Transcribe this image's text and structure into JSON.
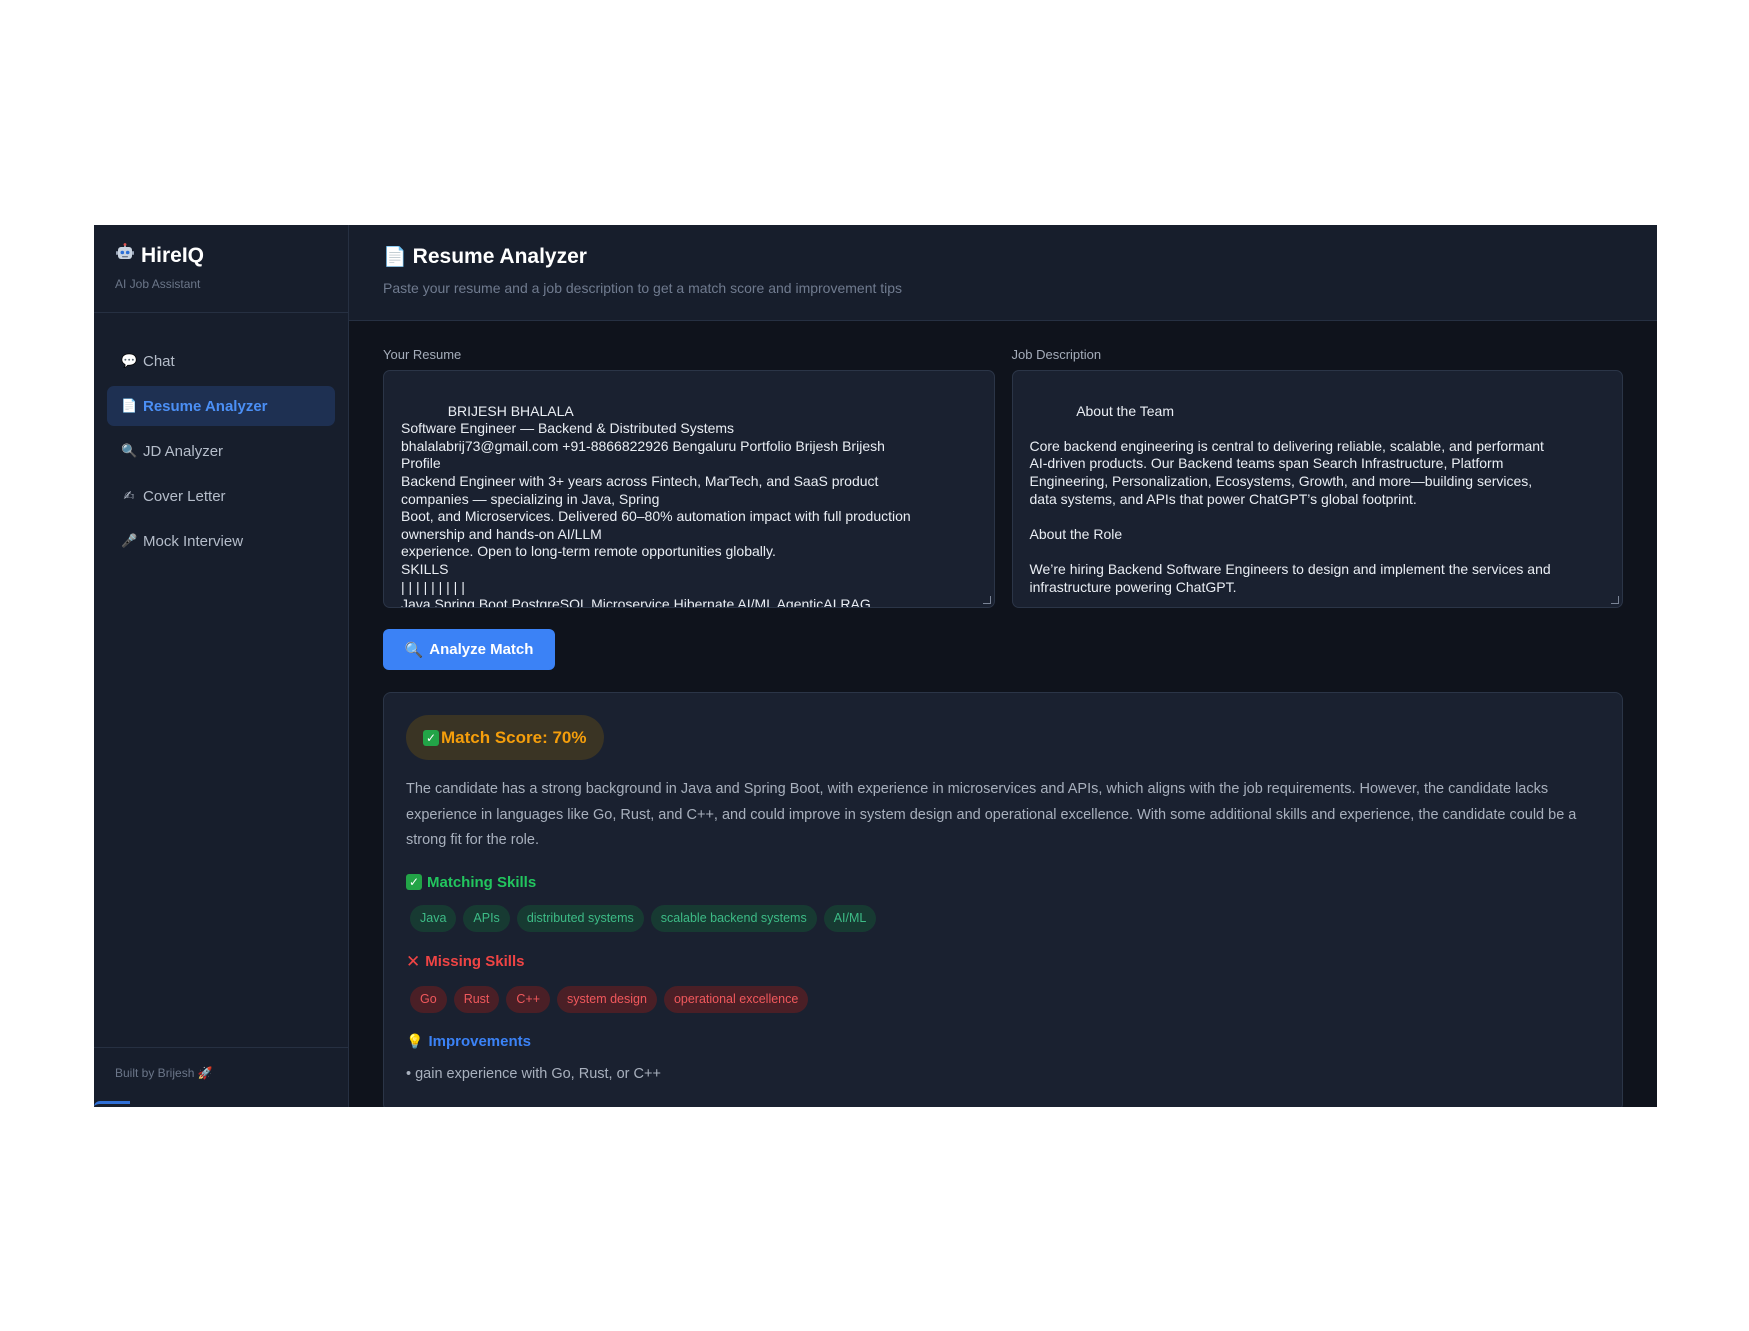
{
  "sidebar": {
    "brand_icon": "robot-icon",
    "brand_title": "HireIQ",
    "brand_subtitle": "AI Job Assistant",
    "items": [
      {
        "label": "Chat",
        "icon": "speech-bubble-icon",
        "active": false
      },
      {
        "label": "Resume Analyzer",
        "icon": "document-icon",
        "active": true
      },
      {
        "label": "JD Analyzer",
        "icon": "magnifier-icon",
        "active": false
      },
      {
        "label": "Cover Letter",
        "icon": "writing-hand-icon",
        "active": false
      },
      {
        "label": "Mock Interview",
        "icon": "microphone-icon",
        "active": false
      }
    ],
    "footer": "Built by Brijesh"
  },
  "header": {
    "title": "Resume Analyzer",
    "subtitle": "Paste your resume and a job description to get a match score and improvement tips"
  },
  "resume": {
    "label": "Your Resume",
    "value": "BRIJESH BHALALA\nSoftware Engineer — Backend & Distributed Systems\nbhalalabrij73@gmail.com +91-8866822926 Bengaluru Portfolio Brijesh Brijesh\nProfile\nBackend Engineer with 3+ years across Fintech, MarTech, and SaaS product\ncompanies — specializing in Java, Spring\nBoot, and Microservices. Delivered 60–80% automation impact with full production\nownership and hands-on AI/LLM\nexperience. Open to long-term remote opportunities globally.\nSKILLS\n| | | | | | | | |\nJava Spring Boot PostgreSQL Microservice Hibernate AI/ML AgenticAI RAG\nLangChain"
  },
  "job_description": {
    "label": "Job Description",
    "value": "About the Team\n\nCore backend engineering is central to delivering reliable, scalable, and performant\nAI-driven products. Our Backend teams span Search Infrastructure, Platform\nEngineering, Personalization, Ecosystems, Growth, and more—building services,\ndata systems, and APIs that power ChatGPT’s global footprint.\n\nAbout the Role\n\nWe’re hiring Backend Software Engineers to design and implement the services and\ninfrastructure powering ChatGPT.\n\nWhat You’ll Do"
  },
  "analyze_button": "Analyze Match",
  "result": {
    "score_label": "Match Score: 70%",
    "summary": "The candidate has a strong background in Java and Spring Boot, with experience in microservices and APIs, which aligns with the job requirements. However, the candidate lacks experience in languages like Go, Rust, and C++, and could improve in system design and operational excellence. With some additional skills and experience, the candidate could be a strong fit for the role.",
    "matching_title": "Matching Skills",
    "matching_skills": [
      "Java",
      "APIs",
      "distributed systems",
      "scalable backend systems",
      "AI/ML"
    ],
    "missing_title": "Missing Skills",
    "missing_skills": [
      "Go",
      "Rust",
      "C++",
      "system design",
      "operational excellence"
    ],
    "improvements_title": "Improvements",
    "improvements": [
      "gain experience with Go, Rust, or C++"
    ]
  },
  "colors": {
    "accent": "#3b82f6",
    "success": "#22c55e",
    "danger": "#ef4444",
    "warning": "#f59e0b",
    "background": "#0f131c",
    "panel": "#1a2130"
  }
}
